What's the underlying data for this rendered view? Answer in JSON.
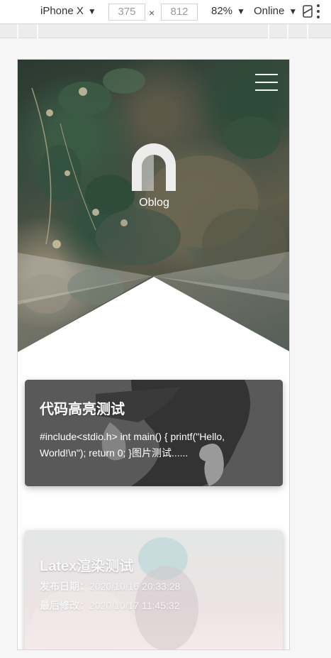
{
  "devtools": {
    "device_name": "iPhone X",
    "width_value": "375",
    "height_value": "812",
    "times_symbol": "×",
    "zoom": "82%",
    "throttling": "Online",
    "dropdown_caret": "▼"
  },
  "site": {
    "name": "Oblog",
    "icons": {
      "menu": "hamburger-icon",
      "logo": "arch-logo"
    }
  },
  "posts": [
    {
      "title": "代码高亮测试",
      "excerpt": "#include<stdio.h> int main() { printf(\"Hello, World!\\n\"); return 0; }图片测试......"
    },
    {
      "title": "Latex渲染测试",
      "published_label": "发布日期：",
      "published_value": "2020/10/16 20:33:28",
      "modified_label": "最后修改：",
      "modified_value": "2020/10/17 11:45:32"
    }
  ],
  "colors": {
    "toolbar_bg": "#ffffff",
    "page_bg": "#f6f6f6",
    "card1_bg": "#5c5c5c",
    "text_light": "#ffffff"
  }
}
